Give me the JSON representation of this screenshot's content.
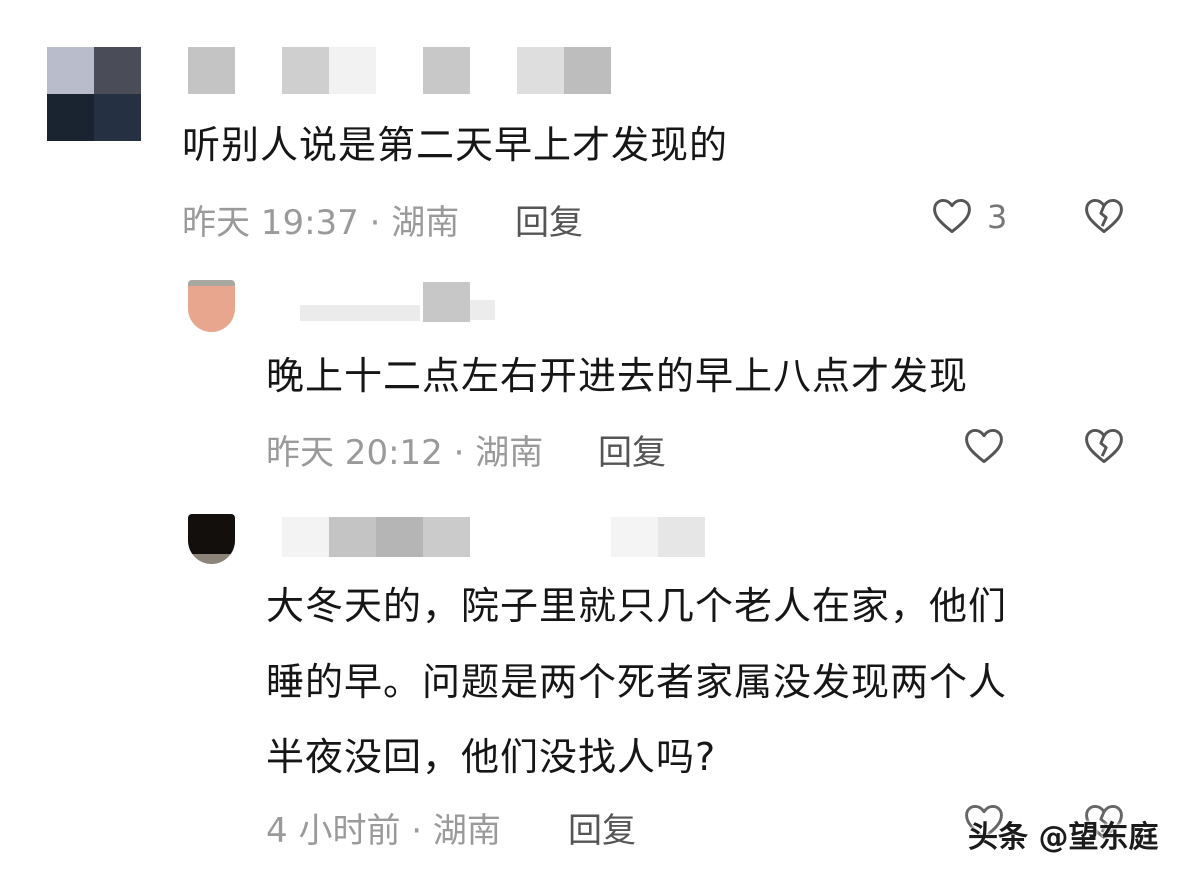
{
  "comments": [
    {
      "text": "听别人说是第二天早上才发现的",
      "meta": "昨天 19:37 · 湖南",
      "reply": "回复",
      "likes": "3"
    },
    {
      "text": "晚上十二点左右开进去的早上八点才发现",
      "meta": "昨天 20:12 · 湖南",
      "reply": "回复"
    },
    {
      "lines": [
        "大冬天的，院子里就只几个老人在家，他们",
        "睡的早。问题是两个死者家属没发现两个人",
        "半夜没回，他们没找人吗?"
      ],
      "meta": "4 小时前 · 湖南",
      "reply": "回复"
    }
  ],
  "icons": {
    "like": "heart-outline-icon",
    "dislike": "broken-heart-icon"
  },
  "watermark": "头条 @望东庭"
}
